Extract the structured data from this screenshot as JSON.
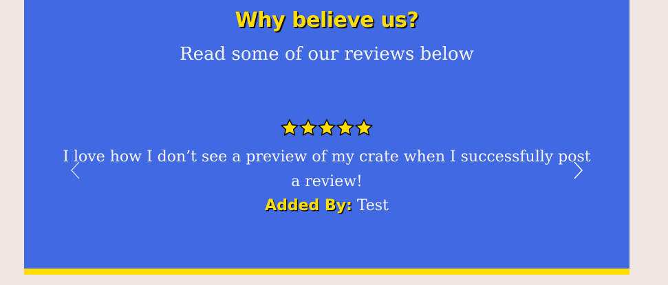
{
  "reviews": {
    "heading": "Why believe us?",
    "subheading": "Read some of our reviews below",
    "current_review": {
      "rating": 5,
      "max_rating": 5,
      "text": "I love how I don’t see a preview of my crate when I successfully post a review!",
      "added_by_label": "Added By:",
      "added_by_name": "Test"
    },
    "carousel": {
      "prev_icon": "chevron-left-icon",
      "next_icon": "chevron-right-icon"
    }
  },
  "colors": {
    "background": "#efe6e4",
    "panel": "#4169e1",
    "accent": "#ffdd00",
    "text": "#f4f4f8"
  }
}
